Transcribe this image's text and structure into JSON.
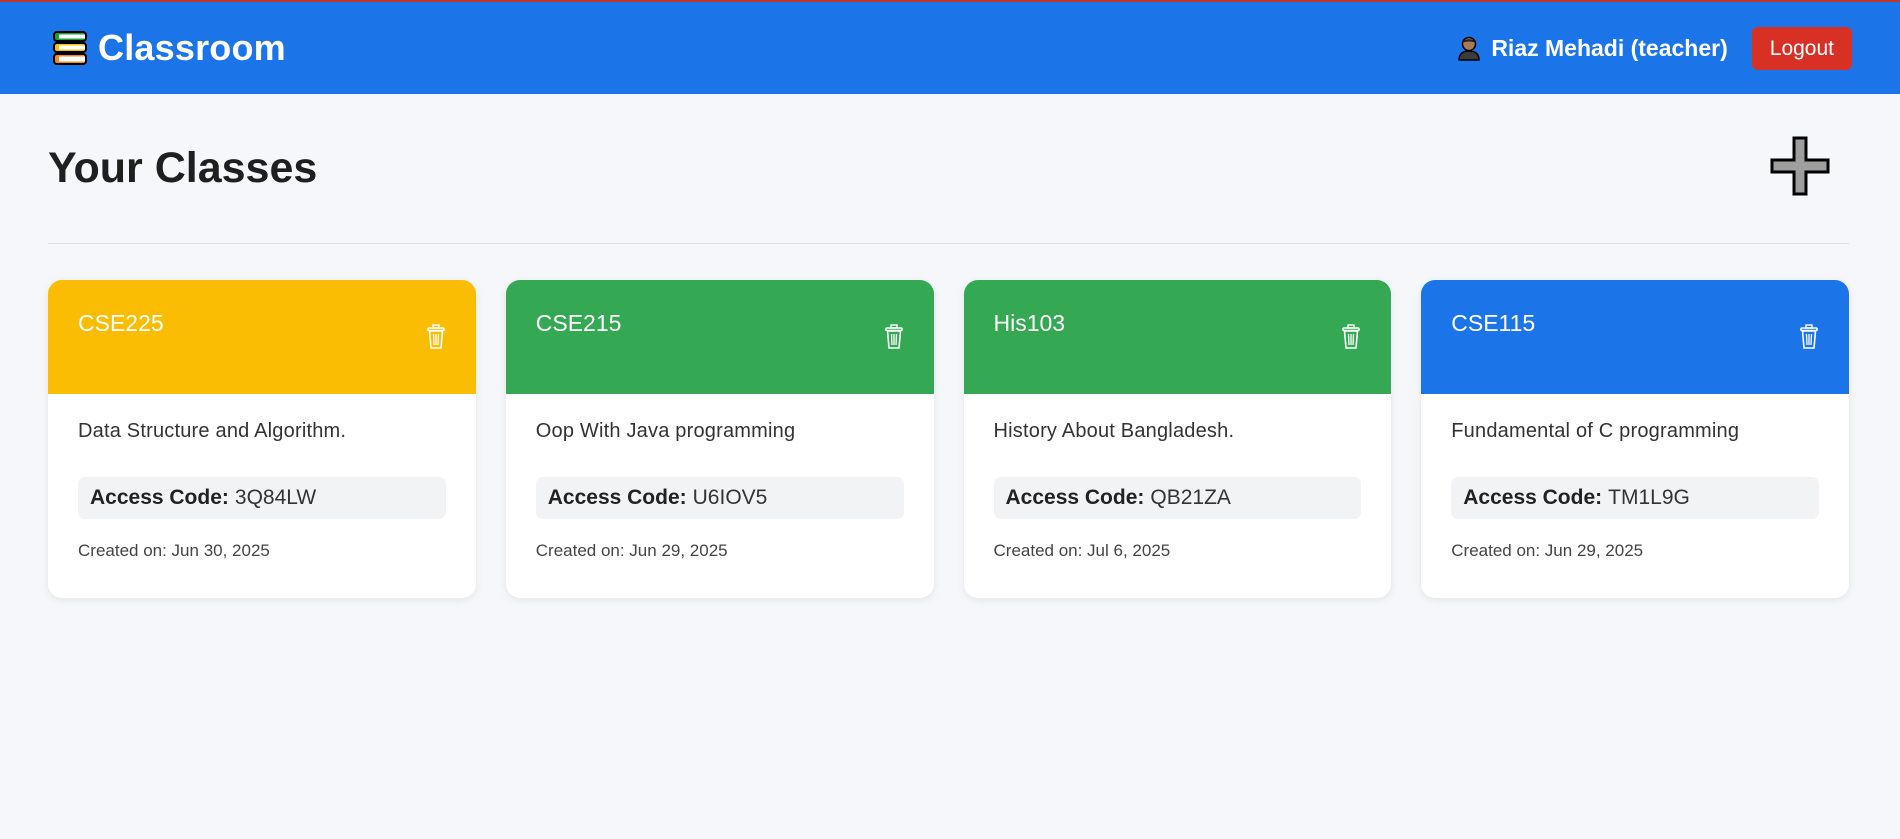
{
  "app": {
    "title": "Classroom",
    "brand_icon": "books-icon"
  },
  "user": {
    "name": "Riaz Mehadi (teacher)",
    "icon": "user-icon",
    "logout_label": "Logout"
  },
  "colors": {
    "primary": "#1c74e9",
    "logout": "#d93025",
    "yellow": "#fbbc04",
    "green": "#34a853",
    "blue": "#1c74e9"
  },
  "main": {
    "title": "Your Classes",
    "add_icon": "plus-icon"
  },
  "classes": [
    {
      "code": "CSE225",
      "color": "#fbbc04",
      "description": "Data Structure and Algorithm.",
      "access_label": "Access Code:",
      "access_code": "3Q84LW",
      "created": "Created on: Jun 30, 2025"
    },
    {
      "code": "CSE215",
      "color": "#34a853",
      "description": "Oop With Java programming",
      "access_label": "Access Code:",
      "access_code": "U6IOV5",
      "created": "Created on: Jun 29, 2025"
    },
    {
      "code": "His103",
      "color": "#34a853",
      "description": "History About Bangladesh.",
      "access_label": "Access Code:",
      "access_code": "QB21ZA",
      "created": "Created on: Jul 6, 2025"
    },
    {
      "code": "CSE115",
      "color": "#1c74e9",
      "description": "Fundamental of C programming",
      "access_label": "Access Code:",
      "access_code": "TM1L9G",
      "created": "Created on: Jun 29, 2025"
    }
  ]
}
